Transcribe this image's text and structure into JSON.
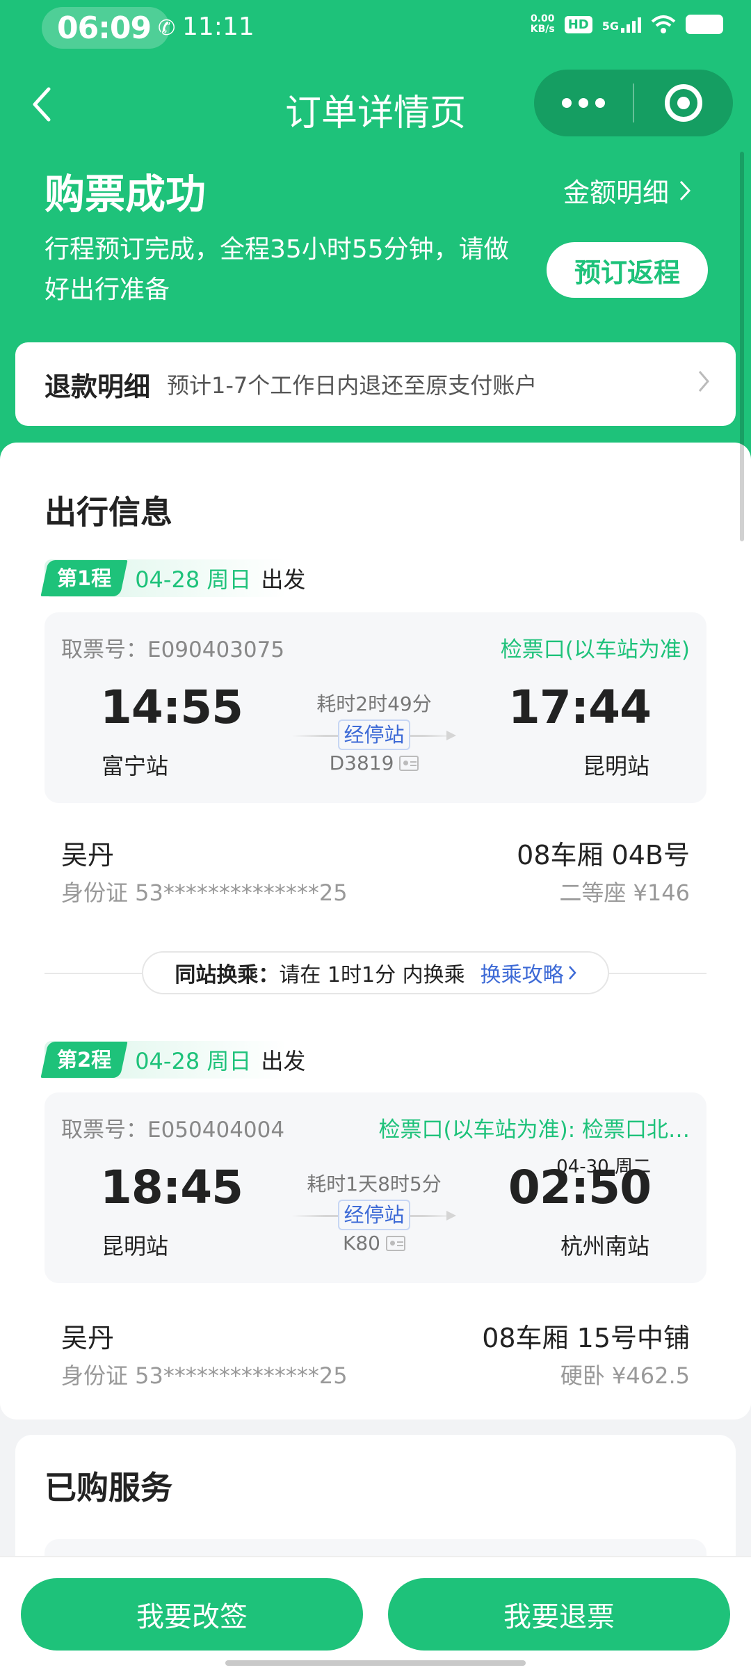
{
  "status_bar": {
    "clock": "06:09",
    "time": "11:11",
    "net_speed_value": "0.00",
    "net_speed_unit": "KB/s",
    "hd": "HD",
    "signal": "5G"
  },
  "nav": {
    "title": "订单详情页"
  },
  "header": {
    "title": "购票成功",
    "amount_detail": "金额明细",
    "description": "行程预订完成，全程35小时55分钟，请做好出行准备",
    "rebook_label": "预订返程"
  },
  "refund": {
    "title": "退款明细",
    "description": "预计1-7个工作日内退还至原支付账户"
  },
  "trip_info": {
    "title": "出行信息",
    "legs": [
      {
        "badge": "第1程",
        "date": "04-28 周日",
        "depart_label": "出发",
        "ticket_no": "取票号：E090403075",
        "gate": "检票口(以车站为准)",
        "dep_time": "14:55",
        "dep_station": "富宁站",
        "duration": "耗时2时49分",
        "stops_label": "经停站",
        "train_no": "D3819",
        "arr_date": "",
        "arr_time": "17:44",
        "arr_station": "昆明站",
        "passenger": "吴丹",
        "id_text": "身份证 53**************25",
        "seat": "08车厢 04B号",
        "price": "二等座 ¥146"
      },
      {
        "badge": "第2程",
        "date": "04-28 周日",
        "depart_label": "出发",
        "ticket_no": "取票号：E050404004",
        "gate": "检票口(以车站为准): 检票口北…",
        "dep_time": "18:45",
        "dep_station": "昆明站",
        "duration": "耗时1天8时5分",
        "stops_label": "经停站",
        "train_no": "K80",
        "arr_date": "04-30 周二",
        "arr_time": "02:50",
        "arr_station": "杭州南站",
        "passenger": "吴丹",
        "id_text": "身份证 53**************25",
        "seat": "08车厢 15号中铺",
        "price": "硬卧 ¥462.5"
      }
    ],
    "transfer": {
      "label": "同站换乘：",
      "text": "请在 1时1分 内换乘",
      "link": "换乘攻略"
    }
  },
  "services": {
    "title": "已购服务"
  },
  "bottom": {
    "change_label": "我要改签",
    "refund_label": "我要退票"
  },
  "colors": {
    "brand_green": "#1ec27a",
    "link_blue": "#3d6ad6"
  }
}
